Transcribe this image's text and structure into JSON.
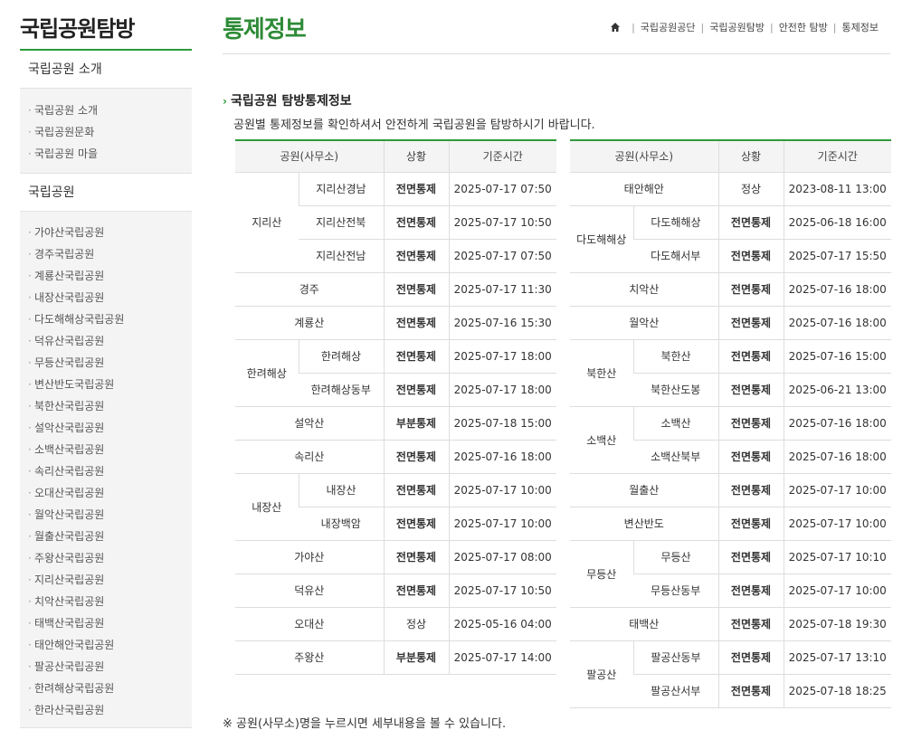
{
  "sidebar": {
    "title": "국립공원탐방",
    "section1": {
      "heading": "국립공원 소개",
      "items": [
        "국립공원 소개",
        "국립공원문화",
        "국립공원 마을"
      ]
    },
    "section2": {
      "heading": "국립공원",
      "items": [
        "가야산국립공원",
        "경주국립공원",
        "계룡산국립공원",
        "내장산국립공원",
        "다도해해상국립공원",
        "덕유산국립공원",
        "무등산국립공원",
        "변산반도국립공원",
        "북한산국립공원",
        "설악산국립공원",
        "소백산국립공원",
        "속리산국립공원",
        "오대산국립공원",
        "월악산국립공원",
        "월출산국립공원",
        "주왕산국립공원",
        "지리산국립공원",
        "치악산국립공원",
        "태백산국립공원",
        "태안해안국립공원",
        "팔공산국립공원",
        "한려해상국립공원",
        "한라산국립공원"
      ]
    }
  },
  "header": {
    "title": "통제정보",
    "breadcrumb": [
      "국립공원공단",
      "국립공원탐방",
      "안전한 탐방",
      "통제정보"
    ],
    "home_icon": "home-icon"
  },
  "section": {
    "title": "국립공원 탐방통제정보",
    "description": "공원별 통제정보를 확인하셔서 안전하게 국립공원을 탐방하시기 바랍니다."
  },
  "table_headers": [
    "공원(사무소)",
    "상황",
    "기준시간"
  ],
  "status_colors": {
    "full": "#e1131a",
    "partial": "#c9920a",
    "normal": "#333333",
    "accent": "#2e9a3a"
  },
  "left_table": [
    {
      "park": "지리산",
      "offices": [
        {
          "office": "지리산경남",
          "status": "전면통제",
          "type": "full",
          "time": "2025-07-17 07:50"
        },
        {
          "office": "지리산전북",
          "status": "전면통제",
          "type": "full",
          "time": "2025-07-17 10:50"
        },
        {
          "office": "지리산전남",
          "status": "전면통제",
          "type": "full",
          "time": "2025-07-17 07:50"
        }
      ]
    },
    {
      "park": "경주",
      "status": "전면통제",
      "type": "full",
      "time": "2025-07-17 11:30"
    },
    {
      "park": "계룡산",
      "status": "전면통제",
      "type": "full",
      "time": "2025-07-16 15:30"
    },
    {
      "park": "한려해상",
      "offices": [
        {
          "office": "한려해상",
          "status": "전면통제",
          "type": "full",
          "time": "2025-07-17 18:00"
        },
        {
          "office": "한려해상동부",
          "status": "전면통제",
          "type": "full",
          "time": "2025-07-17 18:00"
        }
      ]
    },
    {
      "park": "설악산",
      "status": "부분통제",
      "type": "partial",
      "time": "2025-07-18 15:00"
    },
    {
      "park": "속리산",
      "status": "전면통제",
      "type": "full",
      "time": "2025-07-16 18:00"
    },
    {
      "park": "내장산",
      "offices": [
        {
          "office": "내장산",
          "status": "전면통제",
          "type": "full",
          "time": "2025-07-17 10:00"
        },
        {
          "office": "내장백암",
          "status": "전면통제",
          "type": "full",
          "time": "2025-07-17 10:00"
        }
      ]
    },
    {
      "park": "가야산",
      "status": "전면통제",
      "type": "full",
      "time": "2025-07-17 08:00"
    },
    {
      "park": "덕유산",
      "status": "전면통제",
      "type": "full",
      "time": "2025-07-17 10:50"
    },
    {
      "park": "오대산",
      "status": "정상",
      "type": "normal",
      "time": "2025-05-16 04:00"
    },
    {
      "park": "주왕산",
      "status": "부분통제",
      "type": "partial",
      "time": "2025-07-17 14:00"
    }
  ],
  "right_table": [
    {
      "park": "태안해안",
      "status": "정상",
      "type": "normal",
      "time": "2023-08-11 13:00"
    },
    {
      "park": "다도해해상",
      "offices": [
        {
          "office": "다도해해상",
          "status": "전면통제",
          "type": "full",
          "time": "2025-06-18 16:00"
        },
        {
          "office": "다도해서부",
          "status": "전면통제",
          "type": "full",
          "time": "2025-07-17 15:50"
        }
      ]
    },
    {
      "park": "치악산",
      "status": "전면통제",
      "type": "full",
      "time": "2025-07-16 18:00"
    },
    {
      "park": "월악산",
      "status": "전면통제",
      "type": "full",
      "time": "2025-07-16 18:00"
    },
    {
      "park": "북한산",
      "offices": [
        {
          "office": "북한산",
          "status": "전면통제",
          "type": "full",
          "time": "2025-07-16 15:00"
        },
        {
          "office": "북한산도봉",
          "status": "전면통제",
          "type": "full",
          "time": "2025-06-21 13:00"
        }
      ]
    },
    {
      "park": "소백산",
      "offices": [
        {
          "office": "소백산",
          "status": "전면통제",
          "type": "full",
          "time": "2025-07-16 18:00"
        },
        {
          "office": "소백산북부",
          "status": "전면통제",
          "type": "full",
          "time": "2025-07-16 18:00"
        }
      ]
    },
    {
      "park": "월출산",
      "status": "전면통제",
      "type": "full",
      "time": "2025-07-17 10:00"
    },
    {
      "park": "변산반도",
      "status": "전면통제",
      "type": "full",
      "time": "2025-07-17 10:00"
    },
    {
      "park": "무등산",
      "offices": [
        {
          "office": "무등산",
          "status": "전면통제",
          "type": "full",
          "time": "2025-07-17 10:10"
        },
        {
          "office": "무등산동부",
          "status": "전면통제",
          "type": "full",
          "time": "2025-07-17 10:00"
        }
      ]
    },
    {
      "park": "태백산",
      "status": "전면통제",
      "type": "full",
      "time": "2025-07-18 19:30"
    },
    {
      "park": "팔공산",
      "offices": [
        {
          "office": "팔공산동부",
          "status": "전면통제",
          "type": "full",
          "time": "2025-07-17 13:10"
        },
        {
          "office": "팔공산서부",
          "status": "전면통제",
          "type": "full",
          "time": "2025-07-18 18:25"
        }
      ]
    }
  ],
  "footnote": "※ 공원(사무소)명을 누르시면 세부내용을 볼 수 있습니다."
}
